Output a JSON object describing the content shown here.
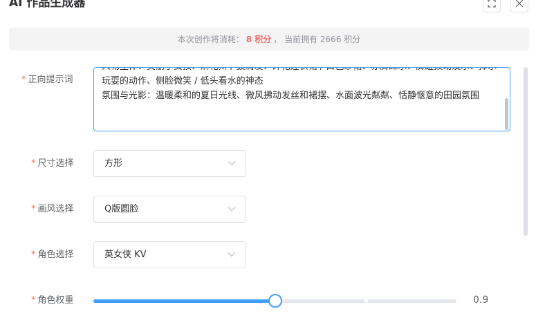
{
  "dialog": {
    "title": "AI 作品生成器"
  },
  "notice": {
    "prefix": "本次创作将消耗：",
    "cost": "8 积分",
    "suffix": "，  当前拥有 2666 积分"
  },
  "form": {
    "prompt": {
      "required_mark": "*",
      "label": "正向提示词",
      "value": "人物主体：美丽小女孩、麻花辫 / 披肩发、碎花连衣裙 / 白色纱裙、赤脚踩水、脚趾拨动溪水、捧水玩耍的动作、侧脸微笑 / 低头看水的神态\n氛围与光影：温暖柔和的夏日光线、微风拂动发丝和裙摆、水面波光粼粼、恬静惬意的田园氛围"
    },
    "size": {
      "required_mark": "*",
      "label": "尺寸选择",
      "value": "方形"
    },
    "style": {
      "required_mark": "*",
      "label": "画风选择",
      "value": "Q版圆脸"
    },
    "character": {
      "required_mark": "*",
      "label": "角色选择",
      "value": "英女侠 KV"
    },
    "weight": {
      "required_mark": "*",
      "label": "角色权重",
      "value": 0.9,
      "display": "0.9",
      "fraction_filled": 0.5
    }
  },
  "colors": {
    "primary": "#409eff",
    "required": "#f56c6c",
    "cost": "#f56c6c"
  }
}
